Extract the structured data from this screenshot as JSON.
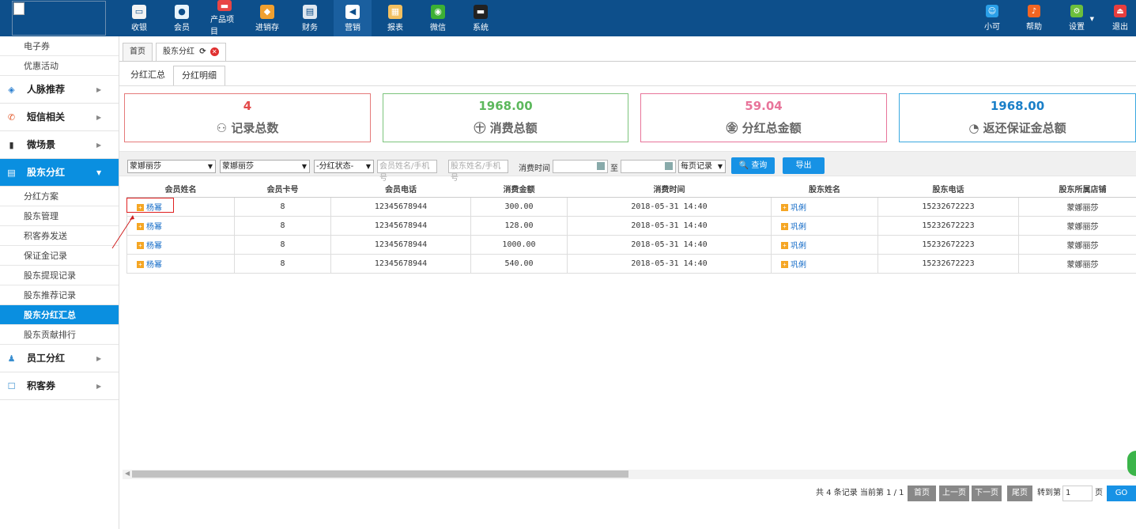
{
  "header": {
    "nav": [
      {
        "label": "收银",
        "icon": "cashier-icon",
        "color": "#f3f3f3"
      },
      {
        "label": "会员",
        "icon": "member-icon",
        "color": "#e8f4fc"
      },
      {
        "label": "产品项目",
        "icon": "product-icon",
        "color": "#e84545"
      },
      {
        "label": "进销存",
        "icon": "inventory-icon",
        "color": "#f0a030"
      },
      {
        "label": "财务",
        "icon": "finance-icon",
        "color": "#e0e8f0"
      },
      {
        "label": "营销",
        "icon": "marketing-icon",
        "color": "#ffffff"
      },
      {
        "label": "报表",
        "icon": "report-icon",
        "color": "#f3c060"
      },
      {
        "label": "微信",
        "icon": "wechat-icon",
        "color": "#3cb034"
      },
      {
        "label": "系统",
        "icon": "system-icon",
        "color": "#222222"
      }
    ],
    "right": [
      {
        "label": "小可",
        "icon": "assistant-icon",
        "color": "#2a9fe8"
      },
      {
        "label": "帮助",
        "icon": "help-icon",
        "color": "#f26522"
      },
      {
        "label": "设置",
        "icon": "settings-icon",
        "color": "#6cbf3c"
      },
      {
        "label": "退出",
        "icon": "logout-icon",
        "color": "#e83e3e"
      }
    ]
  },
  "sidebar": {
    "top_items": [
      "电子券",
      "优惠活动"
    ],
    "groups": [
      {
        "label": "人脉推荐",
        "icon": "network-icon"
      },
      {
        "label": "短信相关",
        "icon": "phone-icon"
      },
      {
        "label": "微场景",
        "icon": "mobile-icon"
      },
      {
        "label": "股东分红",
        "icon": "shareholder-icon"
      }
    ],
    "sub_items": [
      "分红方案",
      "股东管理",
      "积客券发送",
      "保证金记录",
      "股东提现记录",
      "股东推荐记录",
      "股东分红汇总",
      "股东贡献排行"
    ],
    "bottom_groups": [
      {
        "label": "员工分红",
        "icon": "staff-icon"
      },
      {
        "label": "积客券",
        "icon": "coupon-icon"
      }
    ]
  },
  "tabs": {
    "home": "首页",
    "current": "股东分红",
    "refresh": "C"
  },
  "subtabs": [
    "分红汇总",
    "分红明细"
  ],
  "cards": [
    {
      "value": "4",
      "label": "记录总数",
      "icon": "records-icon",
      "color": "#e34a4a",
      "border": "#e57a7a"
    },
    {
      "value": "1968.00",
      "label": "消费总额",
      "icon": "consumption-icon",
      "color": "#5cb85c",
      "border": "#7cc47c"
    },
    {
      "value": "59.04",
      "label": "分红总金额",
      "icon": "dividend-icon",
      "color": "#e8749a",
      "border": "#e8749a"
    },
    {
      "value": "1968.00",
      "label": "返还保证金总额",
      "icon": "refund-icon",
      "color": "#1a7fc8",
      "border": "#3aa8e0"
    }
  ],
  "filters": {
    "store1": "蒙娜丽莎",
    "store2": "蒙娜丽莎",
    "status": "-分红状态-",
    "member_placeholder": "会员姓名/手机号",
    "shareholder_placeholder": "股东姓名/手机号",
    "time_label": "消费时间",
    "to_label": "至",
    "per_page": "每页记录",
    "query": "查询",
    "export": "导出"
  },
  "table": {
    "headers": [
      "会员姓名",
      "会员卡号",
      "会员电话",
      "消费金额",
      "消费时间",
      "股东姓名",
      "股东电话",
      "股东所属店铺"
    ],
    "rows": [
      [
        "杨幂",
        "8",
        "12345678944",
        "300.00",
        "2018-05-31 14:40",
        "巩俐",
        "15232672223",
        "蒙娜丽莎"
      ],
      [
        "杨幂",
        "8",
        "12345678944",
        "128.00",
        "2018-05-31 14:40",
        "巩俐",
        "15232672223",
        "蒙娜丽莎"
      ],
      [
        "杨幂",
        "8",
        "12345678944",
        "1000.00",
        "2018-05-31 14:40",
        "巩俐",
        "15232672223",
        "蒙娜丽莎"
      ],
      [
        "杨幂",
        "8",
        "12345678944",
        "540.00",
        "2018-05-31 14:40",
        "巩俐",
        "15232672223",
        "蒙娜丽莎"
      ]
    ]
  },
  "pager": {
    "summary": "共 4 条记录 当前第 1 / 1",
    "first": "首页",
    "prev": "上一页",
    "next": "下一页",
    "last": "尾页",
    "goto": "转到第",
    "page_value": "1",
    "page_unit": "页",
    "go": "GO"
  }
}
